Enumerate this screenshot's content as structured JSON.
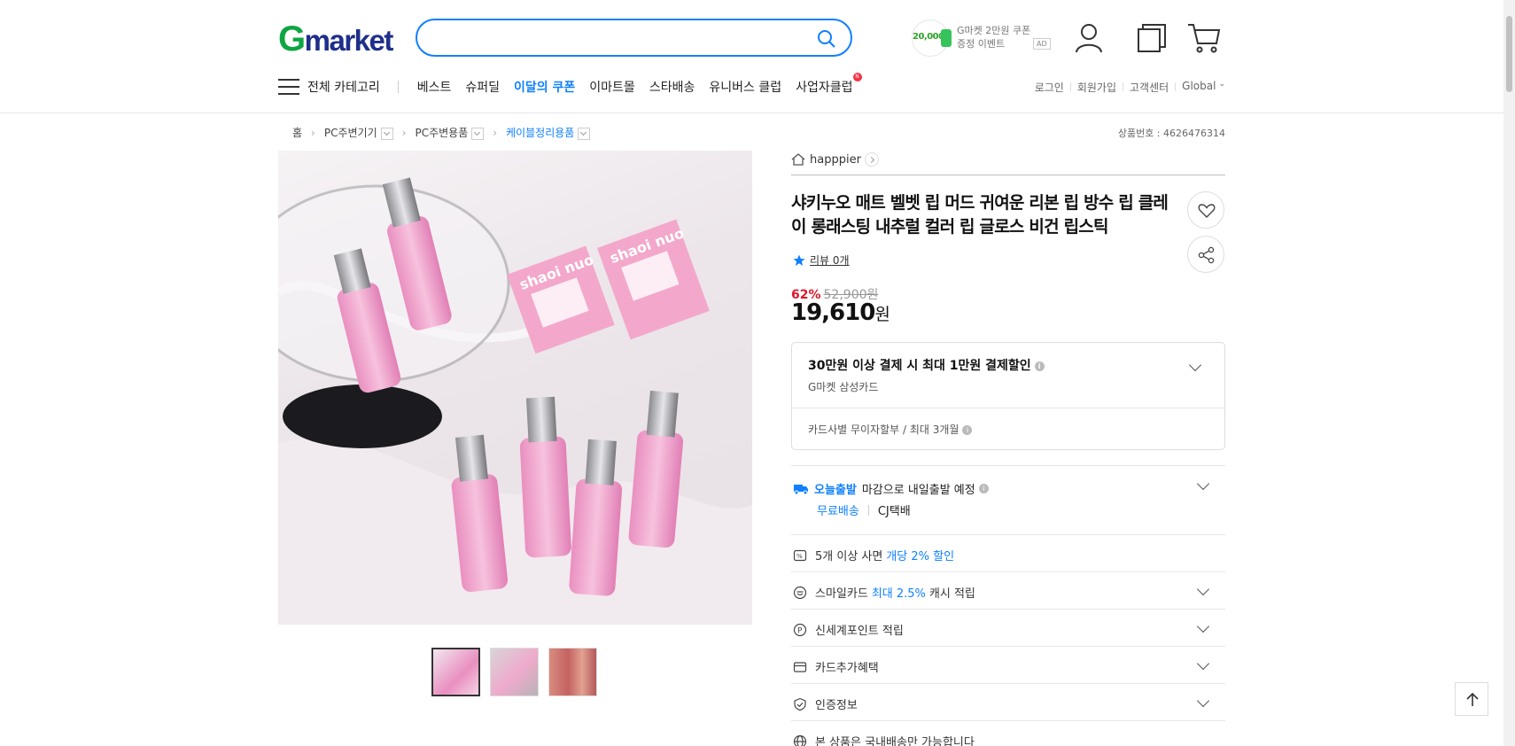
{
  "header": {
    "logo_g": "G",
    "logo_rest": "market",
    "search": {
      "placeholder": ""
    },
    "coupon": {
      "amount": "20,000",
      "line1": "G마켓 2만원 쿠폰",
      "line2": "증정 이벤트",
      "ad": "AD"
    }
  },
  "nav": {
    "all_categories": "전체 카테고리",
    "items": [
      "베스트",
      "슈퍼딜",
      "이달의 쿠폰",
      "이마트몰",
      "스타배송",
      "유니버스 클럽",
      "사업자클럽"
    ],
    "badge": "N",
    "util": [
      "로그인",
      "회원가입",
      "고객센터",
      "Global"
    ]
  },
  "breadcrumb": {
    "home": "홈",
    "items": [
      "PC주변기기",
      "PC주변용품",
      "케이블정리용품"
    ],
    "product_no": "상품번호 : 4626476314"
  },
  "product": {
    "store": "happpier",
    "title": "샤키누오 매트 벨벳 립 머드 귀여운 리본 립 방수 립 클레이 롱래스팅 내추럴 컬러 립 글로스 비건 립스틱",
    "review": "리뷰 0개",
    "discount_pct": "62%",
    "original_price": "52,900원",
    "price_num": "19,610",
    "price_unit": "원",
    "box_label": "shaoi nuo"
  },
  "card_offer": {
    "title": "30만원 이상 결제 시 최대 1만원 결제할인",
    "sub": "G마켓 삼성카드",
    "installment": "카드사별 무이자할부 / 최대 3개월"
  },
  "shipping": {
    "today": "오늘출발",
    "line1_rest": "마감으로 내일출발 예정",
    "free": "무료배송",
    "carrier": "CJ택배"
  },
  "benefits": [
    {
      "pre": "5개 이상 사면",
      "blue": "개당 2% 할인",
      "post": ""
    },
    {
      "pre": "스마일카드",
      "blue": "최대 2.5%",
      "post": "캐시 적립"
    },
    {
      "pre": "신세계포인트 적립",
      "blue": "",
      "post": ""
    },
    {
      "pre": "카드추가혜택",
      "blue": "",
      "post": ""
    },
    {
      "pre": "인증정보",
      "blue": "",
      "post": ""
    },
    {
      "pre": "본 상품은 국내배송만 가능합니다",
      "blue": "",
      "post": ""
    }
  ],
  "colors": {
    "accent": "#0f80ff",
    "discount": "#e2162b",
    "logo_green": "#0fa543",
    "logo_blue": "#1f2f8a"
  }
}
